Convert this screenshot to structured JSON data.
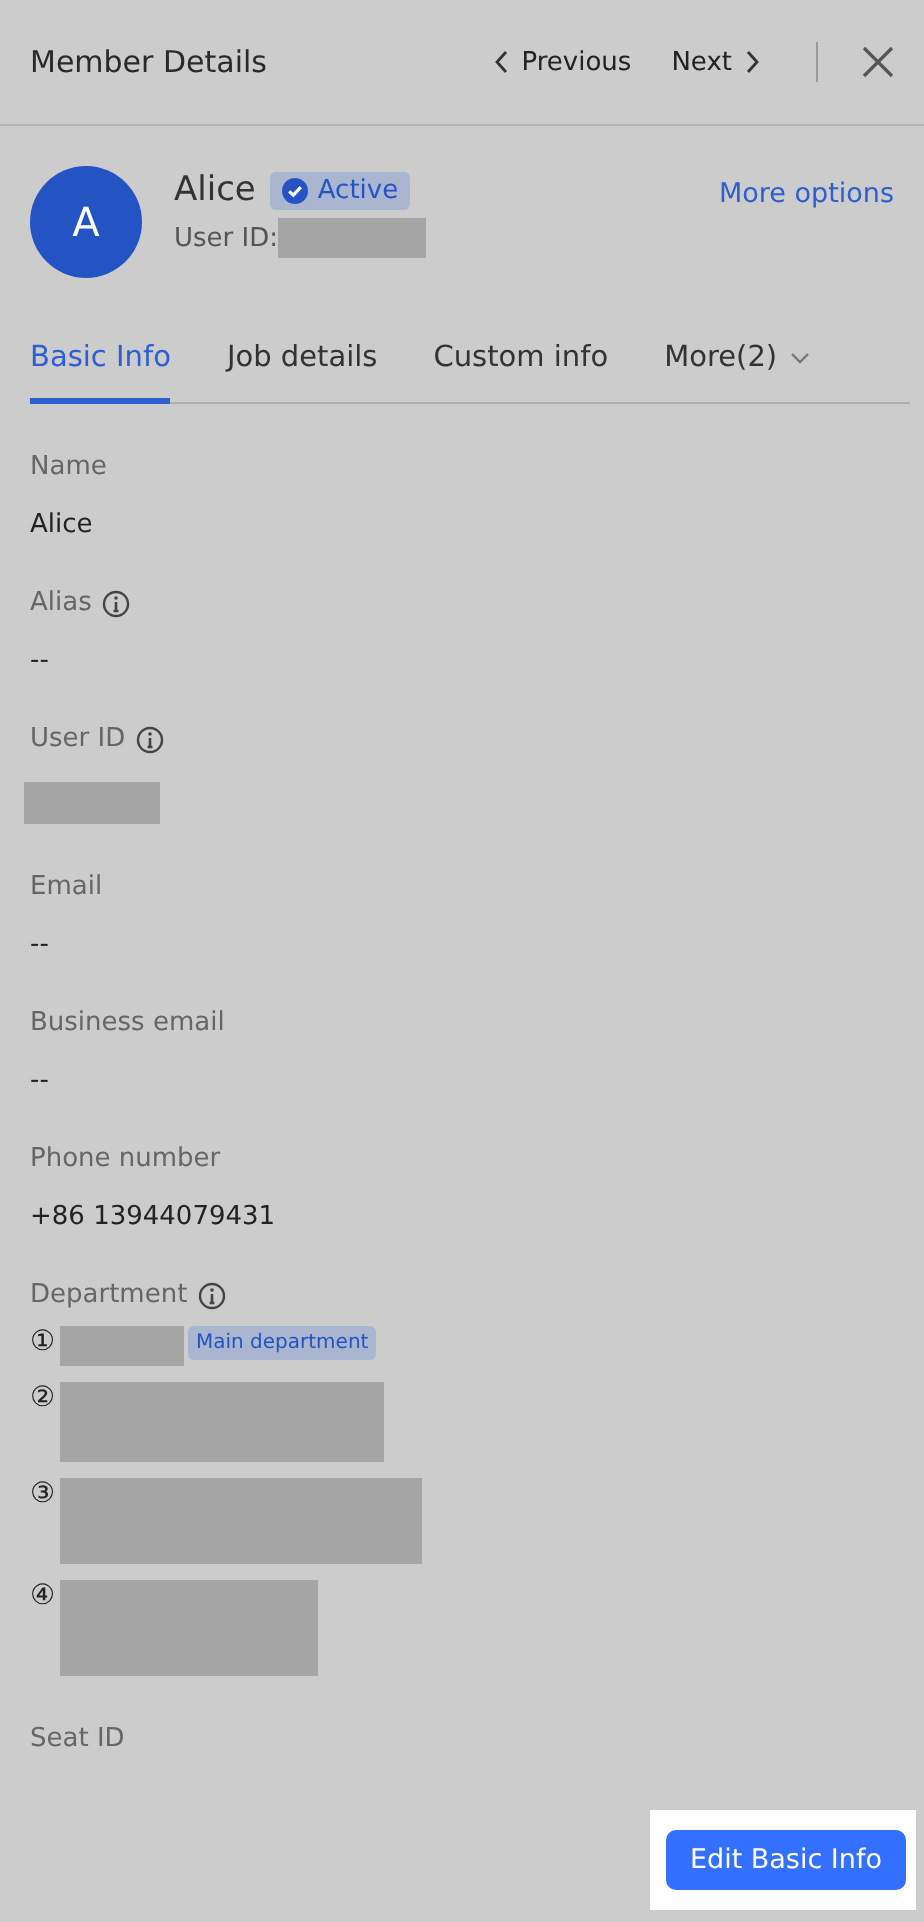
{
  "header": {
    "title": "Member Details",
    "previous": "Previous",
    "next": "Next"
  },
  "profile": {
    "avatar": "A",
    "name": "Alice",
    "status": "Active",
    "user_id_label": "User ID:",
    "more": "More options"
  },
  "tabs": [
    {
      "label": "Basic Info",
      "selected": true
    },
    {
      "label": "Job details",
      "selected": false
    },
    {
      "label": "Custom info",
      "selected": false
    },
    {
      "label": "More(2)",
      "selected": false,
      "dropdown": true
    }
  ],
  "fields": [
    {
      "label": "Name",
      "info": false,
      "kind": "text",
      "value": "Alice"
    },
    {
      "label": "Alias",
      "info": true,
      "kind": "text",
      "value": "--"
    },
    {
      "label": "User ID",
      "info": true,
      "kind": "redacted"
    },
    {
      "label": "Email",
      "info": false,
      "kind": "text",
      "value": "--"
    },
    {
      "label": "Business email",
      "info": false,
      "kind": "text",
      "value": "--"
    },
    {
      "label": "Phone number",
      "info": false,
      "kind": "text",
      "value": "+86 13944079431"
    },
    {
      "label": "Department",
      "info": true,
      "kind": "departments",
      "departments": [
        {
          "marker": "①",
          "badge": "Main department"
        },
        {
          "marker": "②"
        },
        {
          "marker": "③"
        },
        {
          "marker": "④"
        }
      ]
    },
    {
      "label": "Seat ID",
      "info": false,
      "kind": "empty"
    }
  ],
  "footer": {
    "button": "Edit Basic Info"
  }
}
